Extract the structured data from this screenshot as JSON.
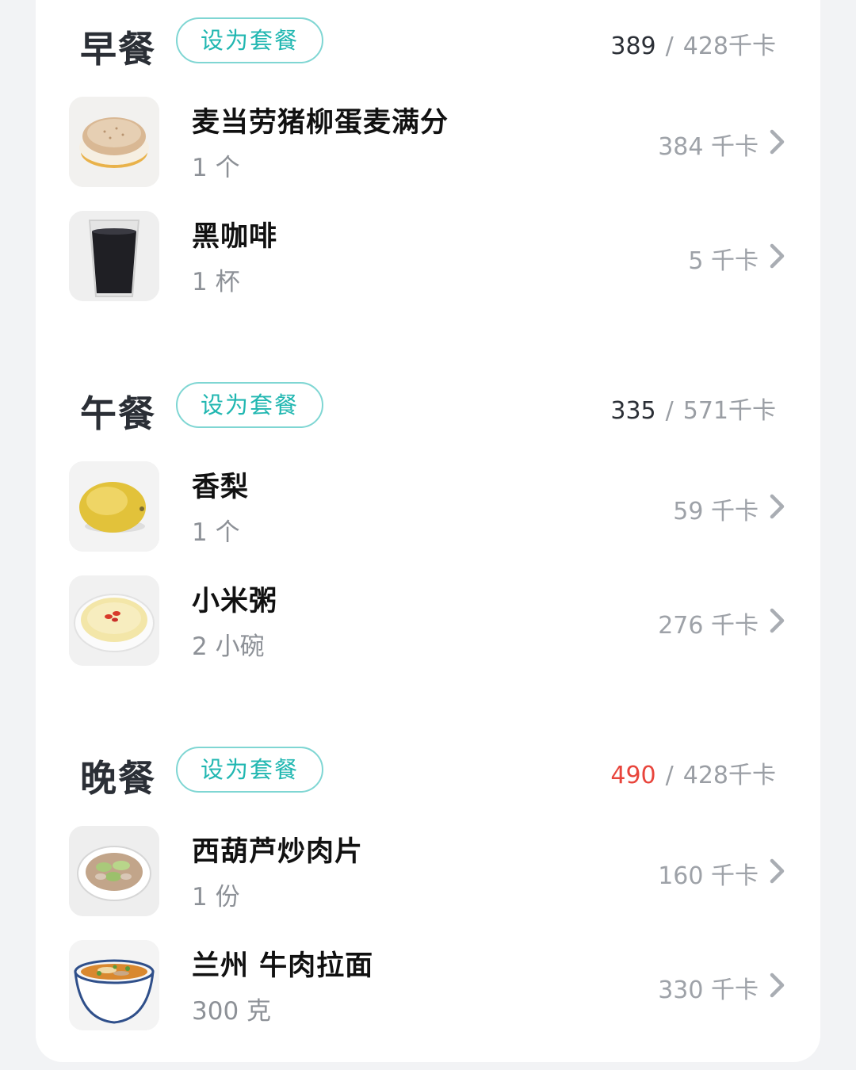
{
  "meals": [
    {
      "title": "早餐",
      "set_button": "设为套餐",
      "current": "389",
      "separator": "/",
      "target": "428千卡",
      "over": false,
      "items": [
        {
          "name": "麦当劳猪柳蛋麦满分",
          "qty": "1 个",
          "cal": "384 千卡",
          "icon": "muffin-sandwich-icon"
        },
        {
          "name": "黑咖啡",
          "qty": "1 杯",
          "cal": "5 千卡",
          "icon": "black-coffee-icon"
        }
      ]
    },
    {
      "title": "午餐",
      "set_button": "设为套餐",
      "current": "335",
      "separator": "/",
      "target": "571千卡",
      "over": false,
      "items": [
        {
          "name": "香梨",
          "qty": "1 个",
          "cal": "59 千卡",
          "icon": "pear-icon"
        },
        {
          "name": "小米粥",
          "qty": "2 小碗",
          "cal": "276 千卡",
          "icon": "millet-porridge-icon"
        }
      ]
    },
    {
      "title": "晚餐",
      "set_button": "设为套餐",
      "current": "490",
      "separator": "/",
      "target": "428千卡",
      "over": true,
      "items": [
        {
          "name": "西葫芦炒肉片",
          "qty": "1 份",
          "cal": "160 千卡",
          "icon": "zucchini-stir-fry-icon"
        },
        {
          "name": "兰州 牛肉拉面",
          "qty": "300 克",
          "cal": "330 千卡",
          "icon": "beef-noodle-icon"
        }
      ]
    }
  ],
  "colors": {
    "accent": "#21b7b1",
    "over": "#e8453c",
    "muted": "#9ea2a8"
  }
}
